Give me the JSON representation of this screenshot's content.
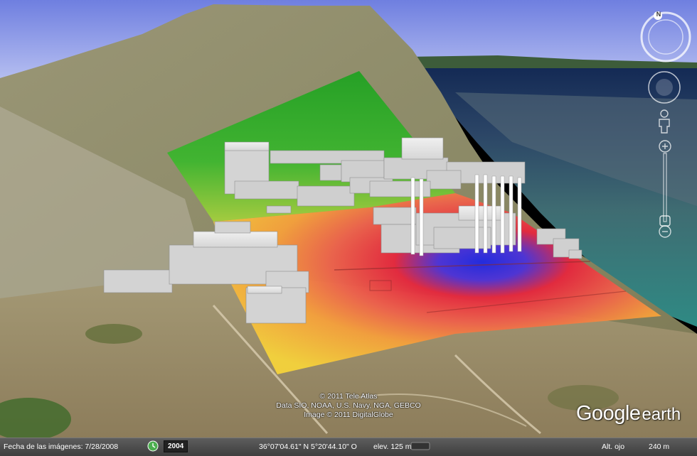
{
  "app": {
    "name": "Google earth",
    "logo_google": "Google",
    "logo_earth": "earth"
  },
  "navigation": {
    "compass_letter": "N",
    "icons": [
      "compass-ring",
      "look-joystick",
      "street-view-pegman",
      "zoom-slider"
    ]
  },
  "copyright": {
    "lines": [
      "© 2011 Tele Atlas",
      "Data SIO, NOAA, U.S. Navy, NGA, GEBCO",
      "Image © 2011 DigitalGlobe"
    ]
  },
  "status_bar": {
    "imagery_date": "Fecha de las imágenes: 7/28/2008",
    "historical_year": "2004",
    "coordinates": "36°07'04.61\" N   5°20'44.10\" O",
    "elevation": "elev.  125 m",
    "eye_alt_label": "Alt. ojo",
    "eye_alt_value": "240 m"
  },
  "colors": {
    "sky": "#7f8fe0",
    "sea": "#2f6f7a",
    "heatmap_high": "#1c25e6",
    "heatmap_mid": "#e8243c",
    "heatmap_low": "#f7c43a",
    "heatmap_outer": "#23b325",
    "building": "#d9d9d9"
  }
}
